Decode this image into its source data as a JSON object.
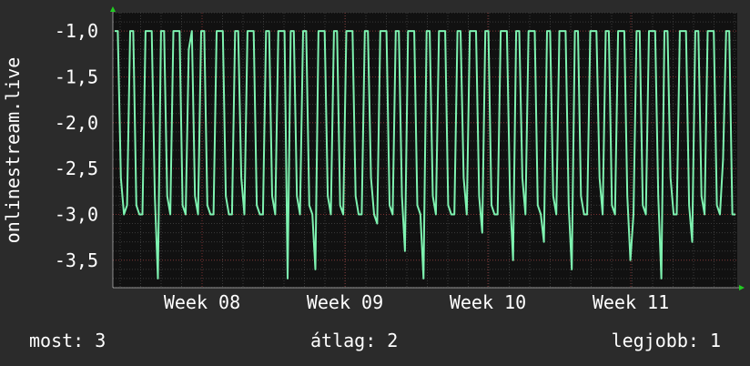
{
  "colors": {
    "background": "#2b2b2b",
    "plot_background": "#111111",
    "grid_minor": "#3a3a3a",
    "grid_major": "#7a2e2e",
    "line": "#7ef2b0",
    "axis_arrow": "#22cc22",
    "text": "#ffffff"
  },
  "chart_data": {
    "type": "line",
    "ylabel": "onlinestream.live",
    "ylim": [
      -3.8,
      -0.8
    ],
    "y_ticks": [
      -1.0,
      -1.5,
      -2.0,
      -2.5,
      -3.0,
      -3.5
    ],
    "y_tick_labels": [
      "-1,0",
      "-1,5",
      "-2,0",
      "-2,5",
      "-3,0",
      "-3,5"
    ],
    "x_ticks": [
      "Week 08",
      "Week 09",
      "Week 10",
      "Week 11"
    ],
    "grid": true,
    "series": [
      {
        "values": [
          -1.0,
          -1.0,
          -2.6,
          -3.0,
          -2.9,
          -1.0,
          -1.0,
          -2.9,
          -3.0,
          -3.0,
          -1.0,
          -1.0,
          -1.0,
          -2.8,
          -3.7,
          -1.0,
          -1.0,
          -2.8,
          -3.0,
          -1.0,
          -1.0,
          -1.0,
          -2.9,
          -3.0,
          -1.2,
          -1.0,
          -2.8,
          -3.0,
          -1.0,
          -1.0,
          -2.9,
          -3.0,
          -3.0,
          -1.0,
          -1.0,
          -1.0,
          -2.8,
          -3.0,
          -3.0,
          -1.0,
          -1.0,
          -2.6,
          -3.0,
          -1.0,
          -1.0,
          -1.0,
          -2.9,
          -3.0,
          -3.0,
          -1.0,
          -1.0,
          -2.8,
          -3.0,
          -1.0,
          -1.0,
          -1.0,
          -3.7,
          -1.0,
          -1.0,
          -2.8,
          -3.0,
          -1.0,
          -1.0,
          -2.9,
          -3.0,
          -3.6,
          -1.0,
          -1.0,
          -1.0,
          -2.8,
          -3.0,
          -1.0,
          -1.0,
          -2.9,
          -3.0,
          -1.0,
          -1.0,
          -1.0,
          -2.8,
          -3.0,
          -3.0,
          -1.0,
          -1.0,
          -2.6,
          -3.0,
          -3.1,
          -1.0,
          -1.0,
          -1.0,
          -2.9,
          -3.0,
          -1.0,
          -1.0,
          -2.8,
          -3.4,
          -1.0,
          -1.0,
          -1.0,
          -2.9,
          -3.0,
          -3.7,
          -1.0,
          -1.0,
          -2.8,
          -3.0,
          -1.0,
          -1.0,
          -1.0,
          -2.9,
          -3.0,
          -3.0,
          -1.0,
          -1.0,
          -2.6,
          -3.0,
          -1.0,
          -1.0,
          -1.0,
          -2.8,
          -3.2,
          -1.0,
          -1.0,
          -2.9,
          -3.0,
          -3.0,
          -1.0,
          -1.0,
          -1.0,
          -2.8,
          -3.5,
          -1.0,
          -1.0,
          -2.6,
          -3.0,
          -1.0,
          -1.0,
          -1.0,
          -2.9,
          -3.0,
          -3.3,
          -1.0,
          -1.0,
          -2.8,
          -3.0,
          -1.0,
          -1.0,
          -1.0,
          -2.9,
          -3.6,
          -1.0,
          -1.0,
          -2.8,
          -3.0,
          -3.0,
          -1.0,
          -1.0,
          -1.0,
          -2.6,
          -3.0,
          -1.0,
          -1.0,
          -2.9,
          -3.0,
          -1.0,
          -1.0,
          -1.0,
          -2.8,
          -3.5,
          -3.0,
          -1.0,
          -1.0,
          -2.9,
          -3.0,
          -1.0,
          -1.0,
          -1.0,
          -2.8,
          -3.7,
          -1.0,
          -1.0,
          -2.6,
          -3.0,
          -3.0,
          -1.0,
          -1.0,
          -1.0,
          -2.9,
          -3.3,
          -1.0,
          -1.0,
          -2.8,
          -3.0,
          -1.0,
          -1.0,
          -1.0,
          -2.9,
          -3.0,
          -2.4,
          -1.0,
          -1.0,
          -3.0,
          -3.0
        ],
        "color": "#7ef2b0"
      }
    ]
  },
  "legend": {
    "now": "most: 3",
    "avg": "átlag: 2",
    "max": "legjobb: 1"
  }
}
